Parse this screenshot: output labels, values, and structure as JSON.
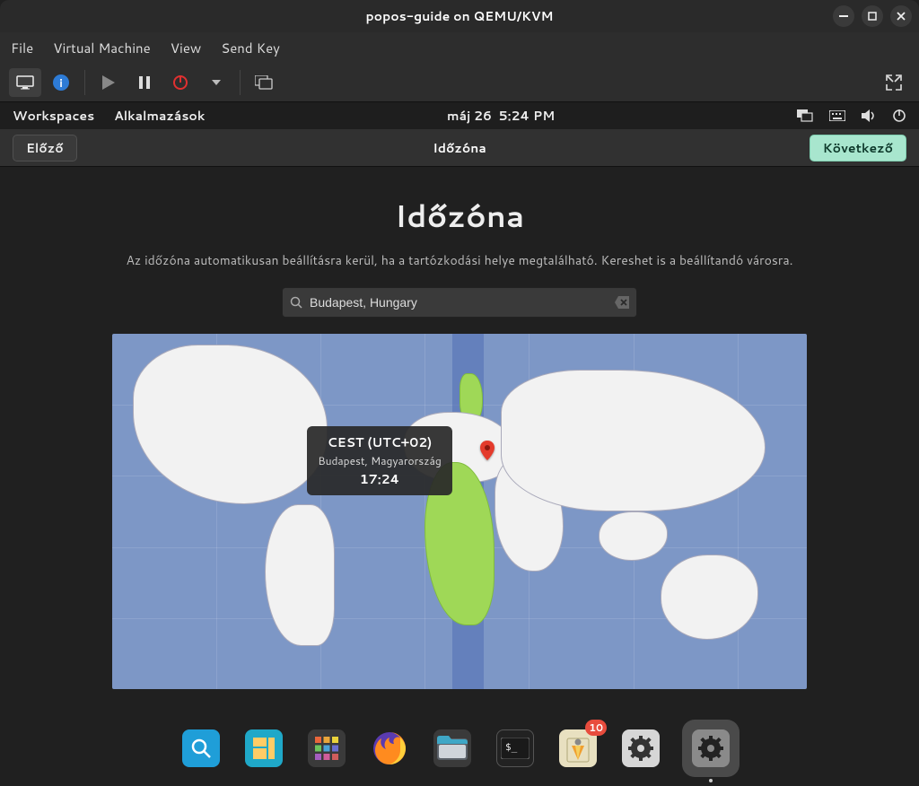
{
  "window": {
    "title": "popos-guide on QEMU/KVM"
  },
  "menu": {
    "file": "File",
    "vm": "Virtual Machine",
    "view": "View",
    "sendkey": "Send Key"
  },
  "gnome": {
    "workspaces": "Workspaces",
    "applications": "Alkalmazások",
    "date": "máj 26",
    "time": "5:24 PM"
  },
  "installer": {
    "header_title": "Időzóna",
    "prev": "Előző",
    "next": "Következő",
    "page_title": "Időzóna",
    "subtitle": "Az időzóna automatikusan beállításra kerül, ha a tartózkodási helye megtalálható. Kereshet is a beállítandó városra.",
    "search_value": "Budapest, Hungary",
    "tooltip": {
      "tz": "CEST (UTC+02)",
      "location": "Budapest, Magyarország",
      "local_time": "17:24"
    }
  },
  "dock": {
    "badge_count": "10"
  }
}
